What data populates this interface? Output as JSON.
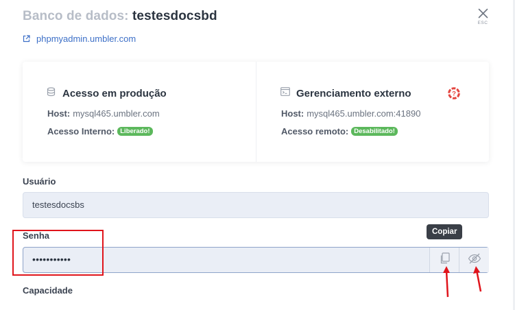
{
  "header": {
    "title_prefix": "Banco de dados:",
    "db_name": "testesdocsbd",
    "close_hint": "ESC",
    "link_text": "phpmyadmin.umbler.com"
  },
  "cards": {
    "production": {
      "title": "Acesso em produção",
      "host_label": "Host:",
      "host_value": "mysql465.umbler.com",
      "access_label": "Acesso Interno:",
      "access_badge": "Liberado!"
    },
    "external": {
      "title": "Gerenciamento externo",
      "host_label": "Host:",
      "host_value": "mysql465.umbler.com:41890",
      "access_label": "Acesso remoto:",
      "access_badge": "Desabilitado!"
    }
  },
  "form": {
    "user_label": "Usuário",
    "user_value": "testesdocsbs",
    "password_label": "Senha",
    "password_masked": "•••••••••••",
    "copy_tooltip": "Copiar",
    "capacity_label": "Capacidade"
  },
  "colors": {
    "badge_green": "#5cb85c",
    "link_blue": "#3c6fc7",
    "annotation_red": "#e0141b"
  },
  "icons": [
    "close-icon",
    "external-link-icon",
    "database-icon",
    "terminal-window-icon",
    "help-lifebuoy-icon",
    "copy-icon",
    "eye-slash-icon"
  ]
}
